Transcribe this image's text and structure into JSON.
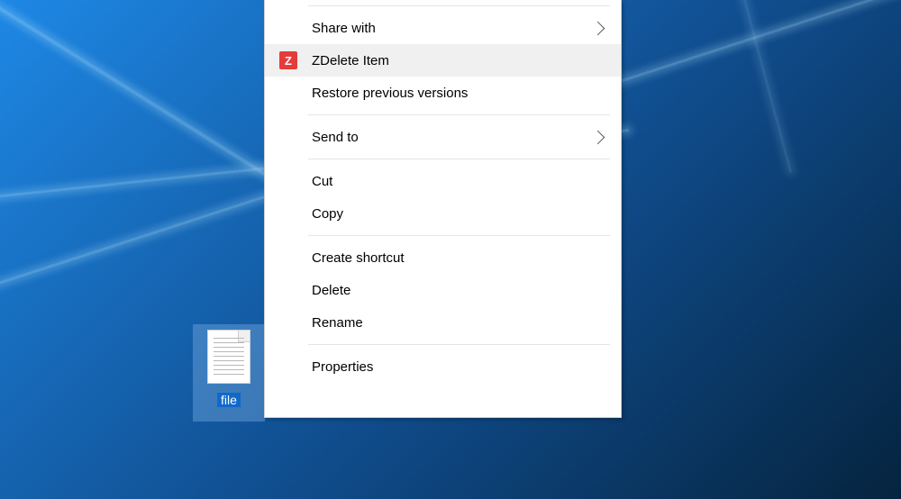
{
  "desktop": {
    "selected_file_label": "file"
  },
  "context_menu": {
    "items": [
      {
        "id": "share-with",
        "label": "Share with",
        "has_submenu": true
      },
      {
        "id": "zdelete-item",
        "label": "ZDelete Item",
        "icon": "Z",
        "hover": true
      },
      {
        "id": "restore-versions",
        "label": "Restore previous versions"
      },
      {
        "id": "send-to",
        "label": "Send to",
        "has_submenu": true
      },
      {
        "id": "cut",
        "label": "Cut"
      },
      {
        "id": "copy",
        "label": "Copy"
      },
      {
        "id": "create-shortcut",
        "label": "Create shortcut"
      },
      {
        "id": "delete",
        "label": "Delete"
      },
      {
        "id": "rename",
        "label": "Rename"
      },
      {
        "id": "properties",
        "label": "Properties"
      }
    ]
  }
}
